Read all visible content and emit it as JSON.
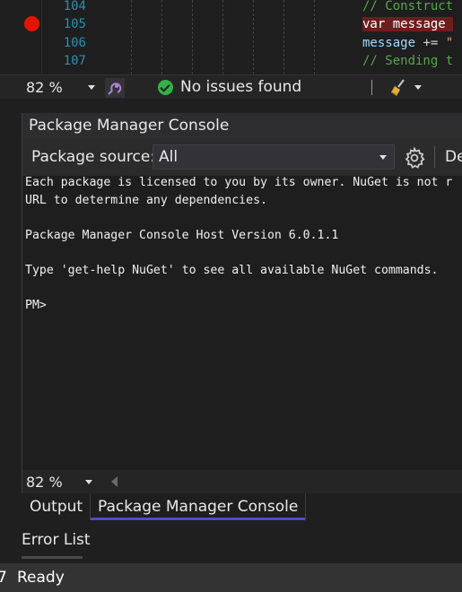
{
  "editor": {
    "line_numbers": [
      "104",
      "105",
      "106",
      "107"
    ],
    "lines": [
      [
        {
          "t": "// Construct",
          "c": "c-comment"
        }
      ],
      [
        {
          "t": "var",
          "c": "c-kw hl"
        },
        {
          "t": " message ",
          "c": "hl"
        }
      ],
      [
        {
          "t": "message",
          "c": "c-id"
        },
        {
          "t": " += ",
          "c": "c-op"
        },
        {
          "t": "\"",
          "c": "c-str"
        }
      ],
      [
        {
          "t": "// Sending t",
          "c": "c-comment"
        }
      ]
    ]
  },
  "editor_status": {
    "zoom": "82 %",
    "issues": "No issues found"
  },
  "tool_window": {
    "title": "Package Manager Console",
    "package_source_label": "Package source:",
    "package_source_value": "All",
    "default_project_label": "De",
    "console_lines": [
      "Each package is licensed to you by its owner. NuGet is not r",
      "URL to determine any dependencies.",
      "",
      "Package Manager Console Host Version 6.0.1.1",
      "",
      "Type 'get-help NuGet' to see all available NuGet commands.",
      "",
      "PM>"
    ],
    "zoom": "82 %"
  },
  "tabs": {
    "output": "Output",
    "pmc": "Package Manager Console"
  },
  "error_list": "Error List",
  "status_bar": {
    "prefix": "7",
    "text": "Ready"
  },
  "colors": {
    "breakpoint": "#e51400",
    "ok": "#35b04a",
    "active_tab_indicator": "#4c4cd0"
  }
}
